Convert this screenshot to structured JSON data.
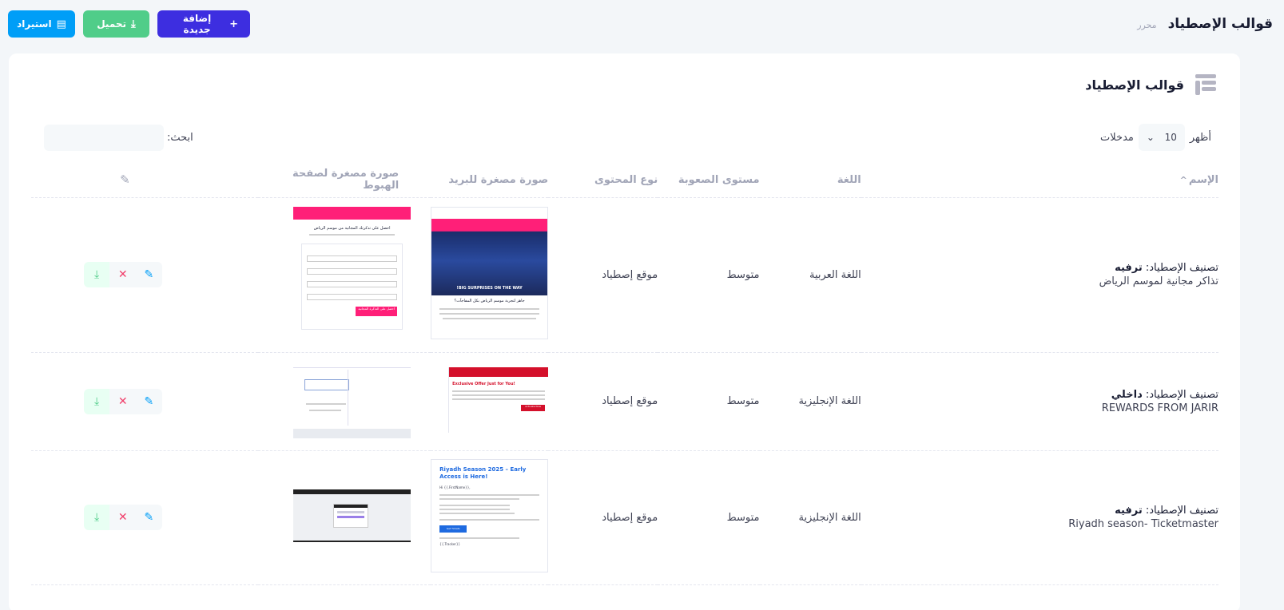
{
  "header": {
    "title": "قوالب الإصطياد",
    "subtitle": "محرر",
    "add_label": "إضافة جديدة",
    "download_label": "تحميل",
    "import_label": "استيراد"
  },
  "card": {
    "title": "قوالب الإصطياد",
    "show_label": "أظهر",
    "page_size": "10",
    "entries_label": "مدخلات",
    "search_label": "ابحث:",
    "search_placeholder": ""
  },
  "table": {
    "headers": {
      "name": "الإسم",
      "language": "اللغة",
      "difficulty": "مستوى الصعوبة",
      "content_type": "نوع المحتوى",
      "email_thumb": "صورة مصغرة للبريد",
      "landing_thumb": "صورة مصغرة لصفحة الهبوط"
    },
    "rows": [
      {
        "category_label": "تصنيف الإصطياد:",
        "category": "ترفيه",
        "name": "تذاكر مجانية لموسم الرياض",
        "language": "اللغة العربية",
        "difficulty": "متوسط",
        "content_type": "موقع إصطياد",
        "email_banner": "BIG SURPRISES ON THE WAY!",
        "email_heading": "جاهز لتجربة موسم الرياض بكل المفاجآت؟",
        "landing_heading": "احصل على تذكرتك المجانية من موسم الرياض",
        "landing_button": "احصل على التذكرة المجانية"
      },
      {
        "category_label": "تصنيف الإصطياد:",
        "category": "داخلي",
        "name": "REWARDS FROM JARIR",
        "language": "اللغة الإنجليزية",
        "difficulty": "متوسط",
        "content_type": "موقع إصطياد",
        "email_heading": "Exclusive Offer Just for You!",
        "email_button": "Activate Now"
      },
      {
        "category_label": "تصنيف الإصطياد:",
        "category": "ترفيه",
        "name": "Riyadh season- Ticketmaster",
        "language": "اللغة الإنجليزية",
        "difficulty": "متوسط",
        "content_type": "موقع إصطياد",
        "email_heading": "Riyadh Season 2025 – Early Access is Here!",
        "email_greeting": "Hi {{.FirstName}},",
        "email_button": "Get Tickets",
        "email_footer": "{{.Tracker}}"
      }
    ]
  },
  "colors": {
    "primary": "#3d2ee0",
    "success": "#50cd89",
    "info": "#009ef7",
    "danger": "#f1416c",
    "brand_pink": "#ff1f78",
    "jarir_red": "#d4102b"
  }
}
